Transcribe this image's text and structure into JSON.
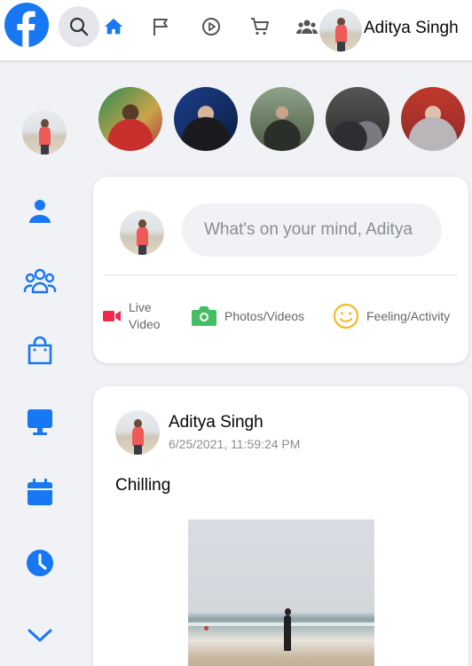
{
  "header": {
    "user_name": "Aditya Singh",
    "icons": [
      "facebook-logo",
      "search-icon",
      "home-icon",
      "flag-icon",
      "watch-icon",
      "marketplace-icon",
      "groups-icon"
    ],
    "accent_color": "#1877f2"
  },
  "sidebar": {
    "icons": [
      "friends-icon",
      "groups-icon",
      "marketplace-icon",
      "watch-icon",
      "events-icon",
      "memories-icon",
      "see-more-chevron-icon"
    ]
  },
  "stories": {
    "count": 5
  },
  "create_post": {
    "placeholder": "What's on your mind, Aditya",
    "actions": [
      {
        "label": "Live\nVideo",
        "icon": "live-video-icon",
        "color": "#f02849"
      },
      {
        "label": "Photos/Videos",
        "icon": "photo-icon",
        "color": "#45bd62"
      },
      {
        "label": "Feeling/Activity",
        "icon": "feeling-icon",
        "color": "#f7b928"
      }
    ]
  },
  "post": {
    "author": "Aditya Singh",
    "timestamp": "6/25/2021, 11:59:24 PM",
    "text": "Chilling"
  }
}
